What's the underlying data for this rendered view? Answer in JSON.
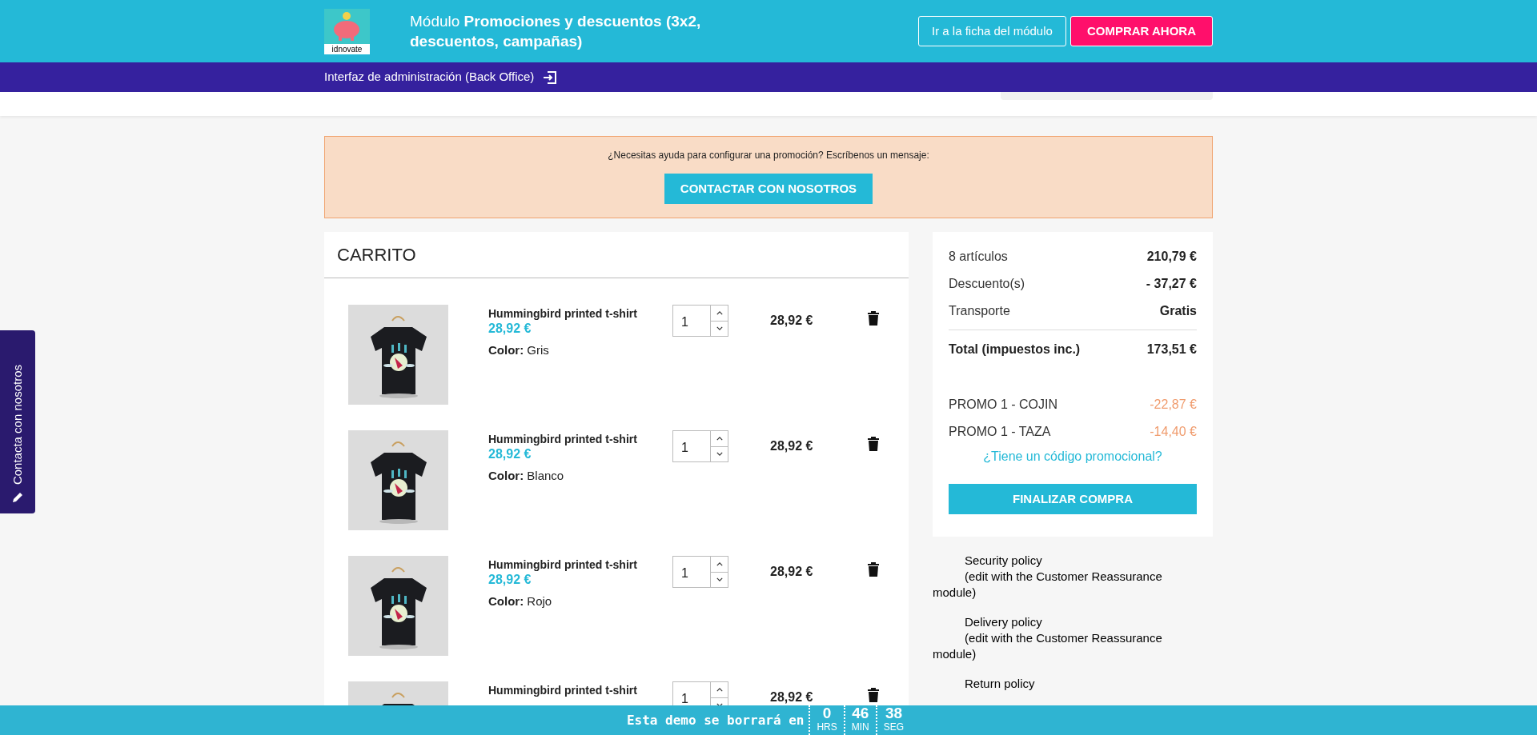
{
  "header": {
    "logo_text": "idnovate",
    "title_prefix": "Módulo ",
    "title_bold": "Promociones y descuentos (3x2, descuentos, campañas)",
    "buttons": [
      {
        "label": "Ir a la ficha del módulo",
        "kind": "outline"
      },
      {
        "label": "COMPRAR AHORA",
        "kind": "primary"
      }
    ]
  },
  "admin_bar": {
    "label": "Interfaz de administración (Back Office)"
  },
  "help_box": {
    "message": "¿Necesitas ayuda para configurar una promoción? Escríbenos un mensaje:",
    "button": "CONTACTAR CON NOSOTROS"
  },
  "cart": {
    "title": "CARRITO",
    "items": [
      {
        "name": "Hummingbird printed t-shirt",
        "price": "28,92 €",
        "color_label": "Color:",
        "color_value": "Gris",
        "quantity": "1",
        "total": "28,92 €"
      },
      {
        "name": "Hummingbird printed t-shirt",
        "price": "28,92 €",
        "color_label": "Color:",
        "color_value": "Blanco",
        "quantity": "1",
        "total": "28,92 €"
      },
      {
        "name": "Hummingbird printed t-shirt",
        "price": "28,92 €",
        "color_label": "Color:",
        "color_value": "Rojo",
        "quantity": "1",
        "total": "28,92 €"
      },
      {
        "name": "Hummingbird printed t-shirt",
        "quantity": "1",
        "total": "28,92 €"
      }
    ]
  },
  "summary": {
    "lines": [
      {
        "kind": "line",
        "label": "8 artículos",
        "value": "210,79 €"
      },
      {
        "kind": "line",
        "label": "Descuento(s)",
        "value": "- 37,27 €"
      },
      {
        "kind": "line",
        "label": "Transporte",
        "value": "Gratis"
      },
      {
        "kind": "total",
        "label": "Total (impuestos inc.)",
        "value": "173,51 €"
      },
      {
        "kind": "promo",
        "label": "PROMO 1 - COJIN",
        "value": "-22,87 €"
      },
      {
        "kind": "promo",
        "label": "PROMO 1 - TAZA",
        "value": "-14,40 €"
      }
    ],
    "promo_link": "¿Tiene un código promocional?",
    "checkout": "FINALIZAR COMPRA"
  },
  "policies": [
    {
      "title": "Security policy",
      "note": "(edit with the Customer Reassurance module)"
    },
    {
      "title": "Delivery policy",
      "note": "(edit with the Customer Reassurance module)"
    },
    {
      "title": "Return policy"
    }
  ],
  "side_tab": {
    "label": "Contacta con nosotros"
  },
  "countdown": {
    "label": "Esta demo se borrará en",
    "units": [
      {
        "value": "0",
        "unit": "HRS"
      },
      {
        "value": "46",
        "unit": "MIN"
      },
      {
        "value": "38",
        "unit": "SEG"
      }
    ]
  }
}
